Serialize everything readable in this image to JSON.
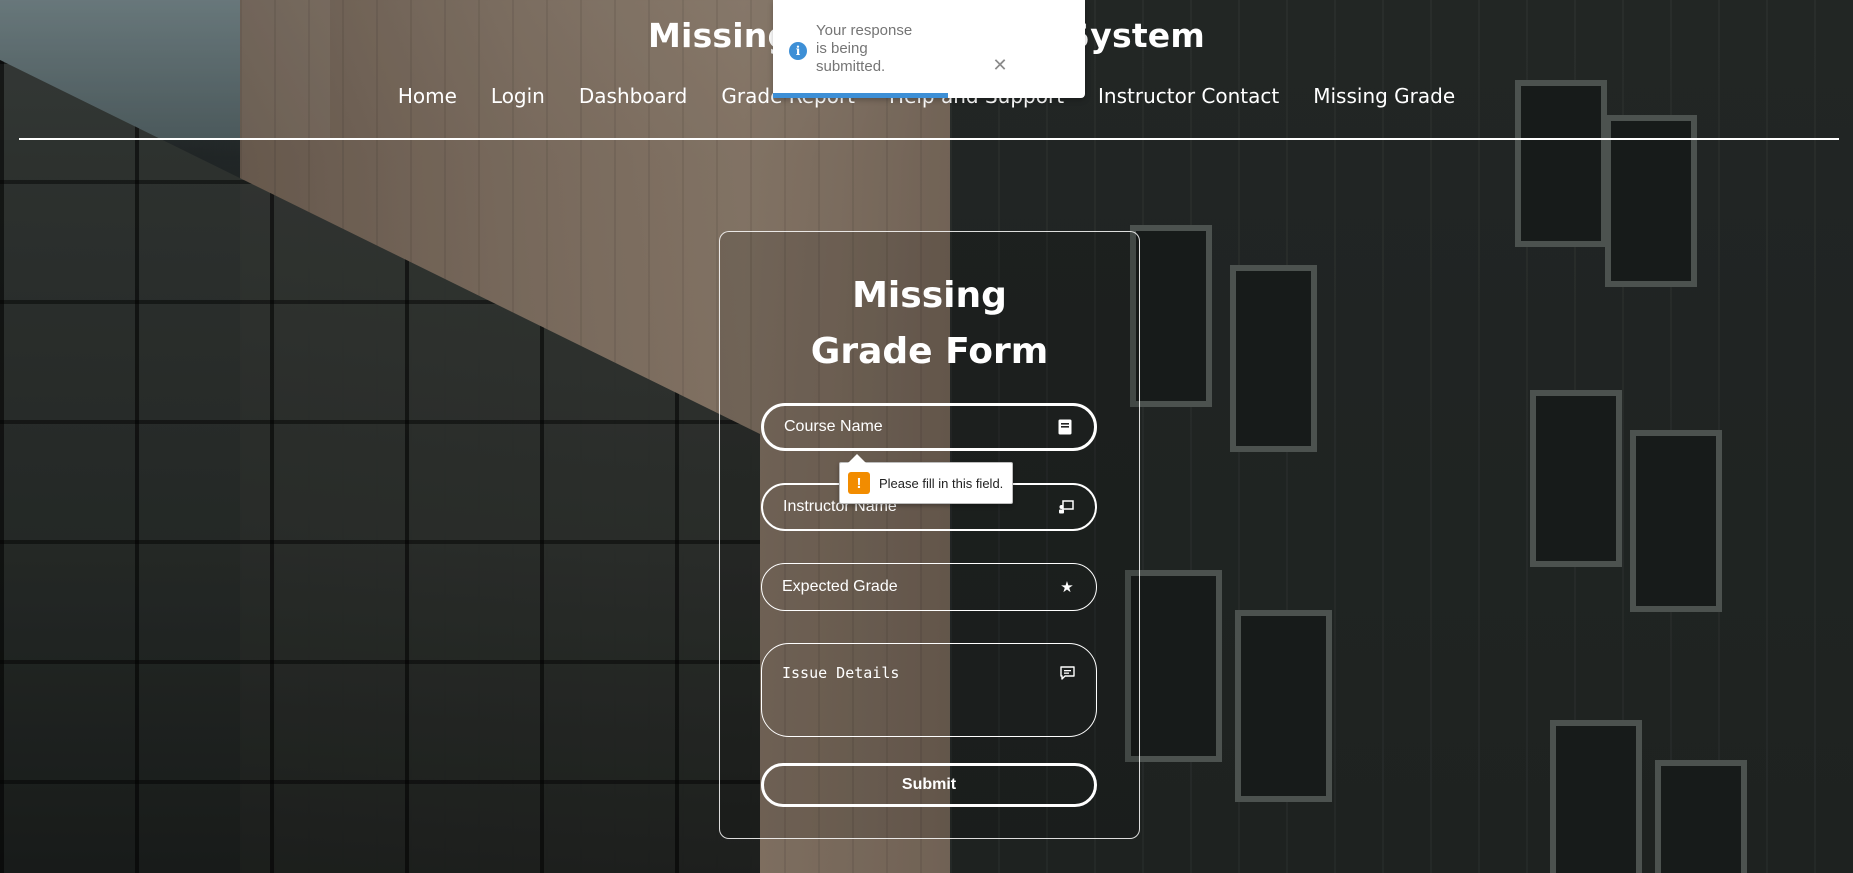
{
  "header": {
    "site_title": "Missing Grade Report System",
    "nav": [
      {
        "label": "Home"
      },
      {
        "label": "Login"
      },
      {
        "label": "Dashboard"
      },
      {
        "label": "Grade Report"
      },
      {
        "label": "Help and Support"
      },
      {
        "label": "Instructor Contact"
      },
      {
        "label": "Missing Grade"
      }
    ]
  },
  "form": {
    "title": "Missing Grade Form",
    "fields": [
      {
        "placeholder": "Course Name",
        "icon": "book-icon"
      },
      {
        "placeholder": "Instructor Name",
        "icon": "instructor-icon"
      },
      {
        "placeholder": "Expected Grade",
        "icon": "star-icon"
      },
      {
        "placeholder": "Issue Details",
        "icon": "comment-icon"
      }
    ],
    "submit_label": "Submit"
  },
  "validation": {
    "message": "Please fill in this field.",
    "icon": "warning-icon"
  },
  "toast": {
    "message": "Your response is being submitted.",
    "icon": "info-icon",
    "progress": 0.56,
    "colors": {
      "accent": "#3d8fd6"
    }
  }
}
